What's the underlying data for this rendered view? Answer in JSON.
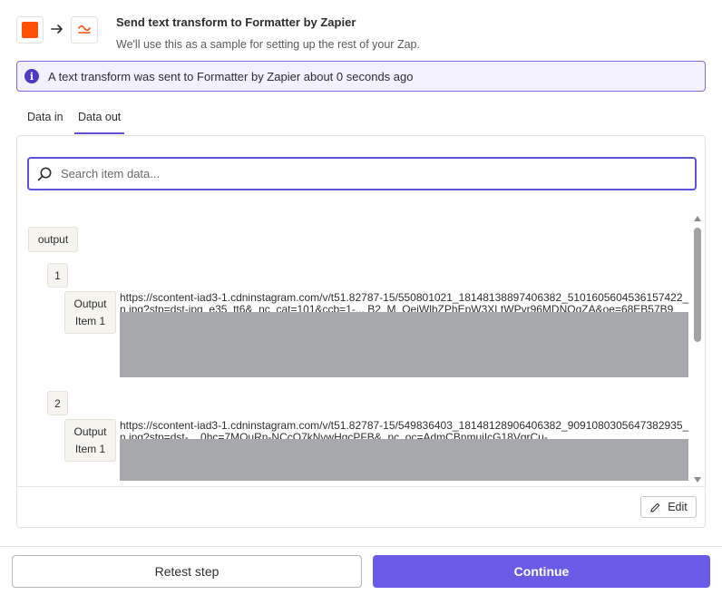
{
  "header": {
    "title": "Send text transform to Formatter by Zapier",
    "subtitle": "We'll use this as a sample for setting up the rest of your Zap.",
    "trigger_icon": "orange-square-icon",
    "action_icon": "formatter-icon",
    "arrow_icon": "arrow-right-icon"
  },
  "banner": {
    "icon": "info-icon",
    "icon_glyph": "i",
    "text": "A text transform was sent to Formatter by Zapier about 0 seconds ago"
  },
  "tabs": [
    {
      "label": "Data in",
      "active": false
    },
    {
      "label": "Data out",
      "active": true
    }
  ],
  "search": {
    "placeholder": "Search item data...",
    "value": ""
  },
  "tree": {
    "root_label": "output",
    "items": [
      {
        "index": "1",
        "key_line1": "Output",
        "key_line2": "Item 1",
        "value": "https://scontent-iad3-1.cdninstagram.com/v/t51.82787-15/550801021_18148138897406382_5101605604536157422_n.jpg?stp=dst-jpg_e35_tt6&_nc_cat=101&ccb=1-... B2_M_OejWlbZPhEpW3XLtWPyr96MDNQqZA&oe=68EB57B9"
      },
      {
        "index": "2",
        "key_line1": "Output",
        "key_line2": "Item 1",
        "value": "https://scontent-iad3-1.cdninstagram.com/v/t51.82787-15/549836403_18148128906406382_9091080305647382935_n.jpg?stp=dst-... 0hc=7MOuRn-NCcQ7kNvwHgcPFB&_nc_oc=AdmCBnmujIcG18VgrCu-"
      }
    ]
  },
  "edit_button": {
    "label": "Edit",
    "icon": "pencil-icon"
  },
  "footer": {
    "retest_label": "Retest step",
    "continue_label": "Continue"
  },
  "colors": {
    "accent": "#6a5be6",
    "brand_orange": "#ff4f00",
    "redaction": "#a7a8ab"
  }
}
